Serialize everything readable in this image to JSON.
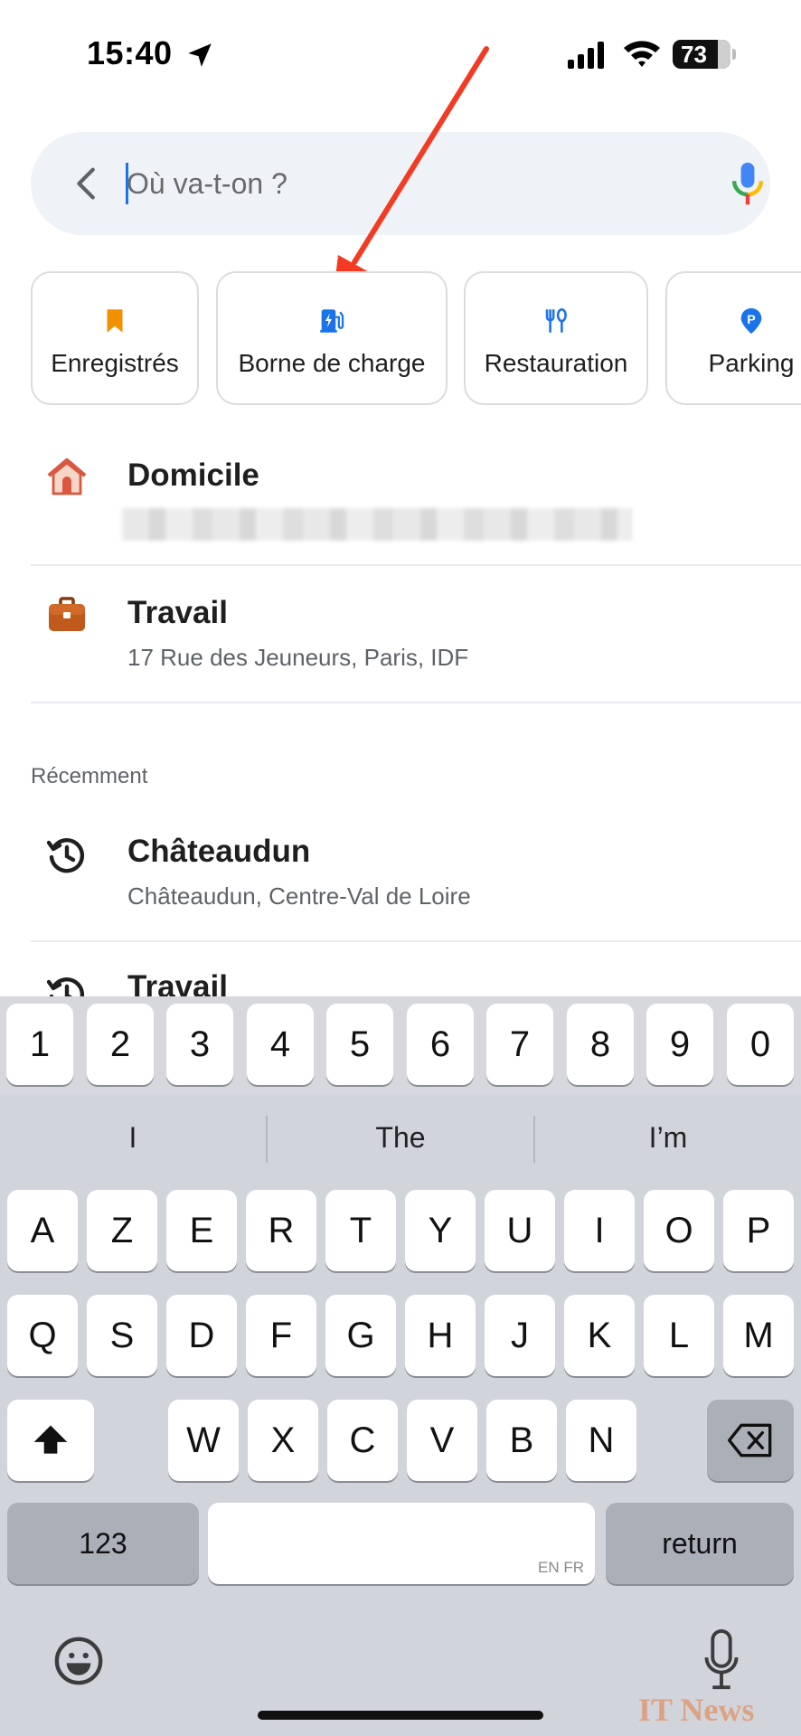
{
  "status_bar": {
    "time": "15:40",
    "battery": "73"
  },
  "search": {
    "placeholder": "Où va-t-on ?"
  },
  "chips": [
    {
      "label": "Enregistrés",
      "icon": "bookmark-icon",
      "color": "#f29100"
    },
    {
      "label": "Borne de charge",
      "icon": "ev-charger-icon",
      "color": "#1a73e8"
    },
    {
      "label": "Restauration",
      "icon": "restaurant-icon",
      "color": "#1a73e8"
    },
    {
      "label": "Parking",
      "icon": "parking-icon",
      "color": "#1a73e8"
    }
  ],
  "places": {
    "home": {
      "title": "Domicile",
      "icon": "home-icon"
    },
    "work": {
      "title": "Travail",
      "subtitle": "17 Rue des Jeuneurs, Paris, IDF",
      "icon": "briefcase-icon"
    }
  },
  "recent": {
    "label": "Récemment",
    "items": [
      {
        "title": "Châteaudun",
        "subtitle": "Châteaudun, Centre-Val de Loire",
        "icon": "history-icon"
      },
      {
        "title": "Travail",
        "icon": "history-icon"
      }
    ]
  },
  "keyboard": {
    "numbers": [
      "1",
      "2",
      "3",
      "4",
      "5",
      "6",
      "7",
      "8",
      "9",
      "0"
    ],
    "suggestions": [
      "I",
      "The",
      "I’m"
    ],
    "row1": [
      "A",
      "Z",
      "E",
      "R",
      "T",
      "Y",
      "U",
      "I",
      "O",
      "P"
    ],
    "row2": [
      "Q",
      "S",
      "D",
      "F",
      "G",
      "H",
      "J",
      "K",
      "L",
      "M"
    ],
    "row3": [
      "W",
      "X",
      "C",
      "V",
      "B",
      "N"
    ],
    "numbers_key": "123",
    "return_key": "return",
    "space_hint": "EN FR"
  },
  "watermark": "IT News",
  "colors": {
    "accent": "#1a73e8",
    "annotation": "#f23b22"
  }
}
